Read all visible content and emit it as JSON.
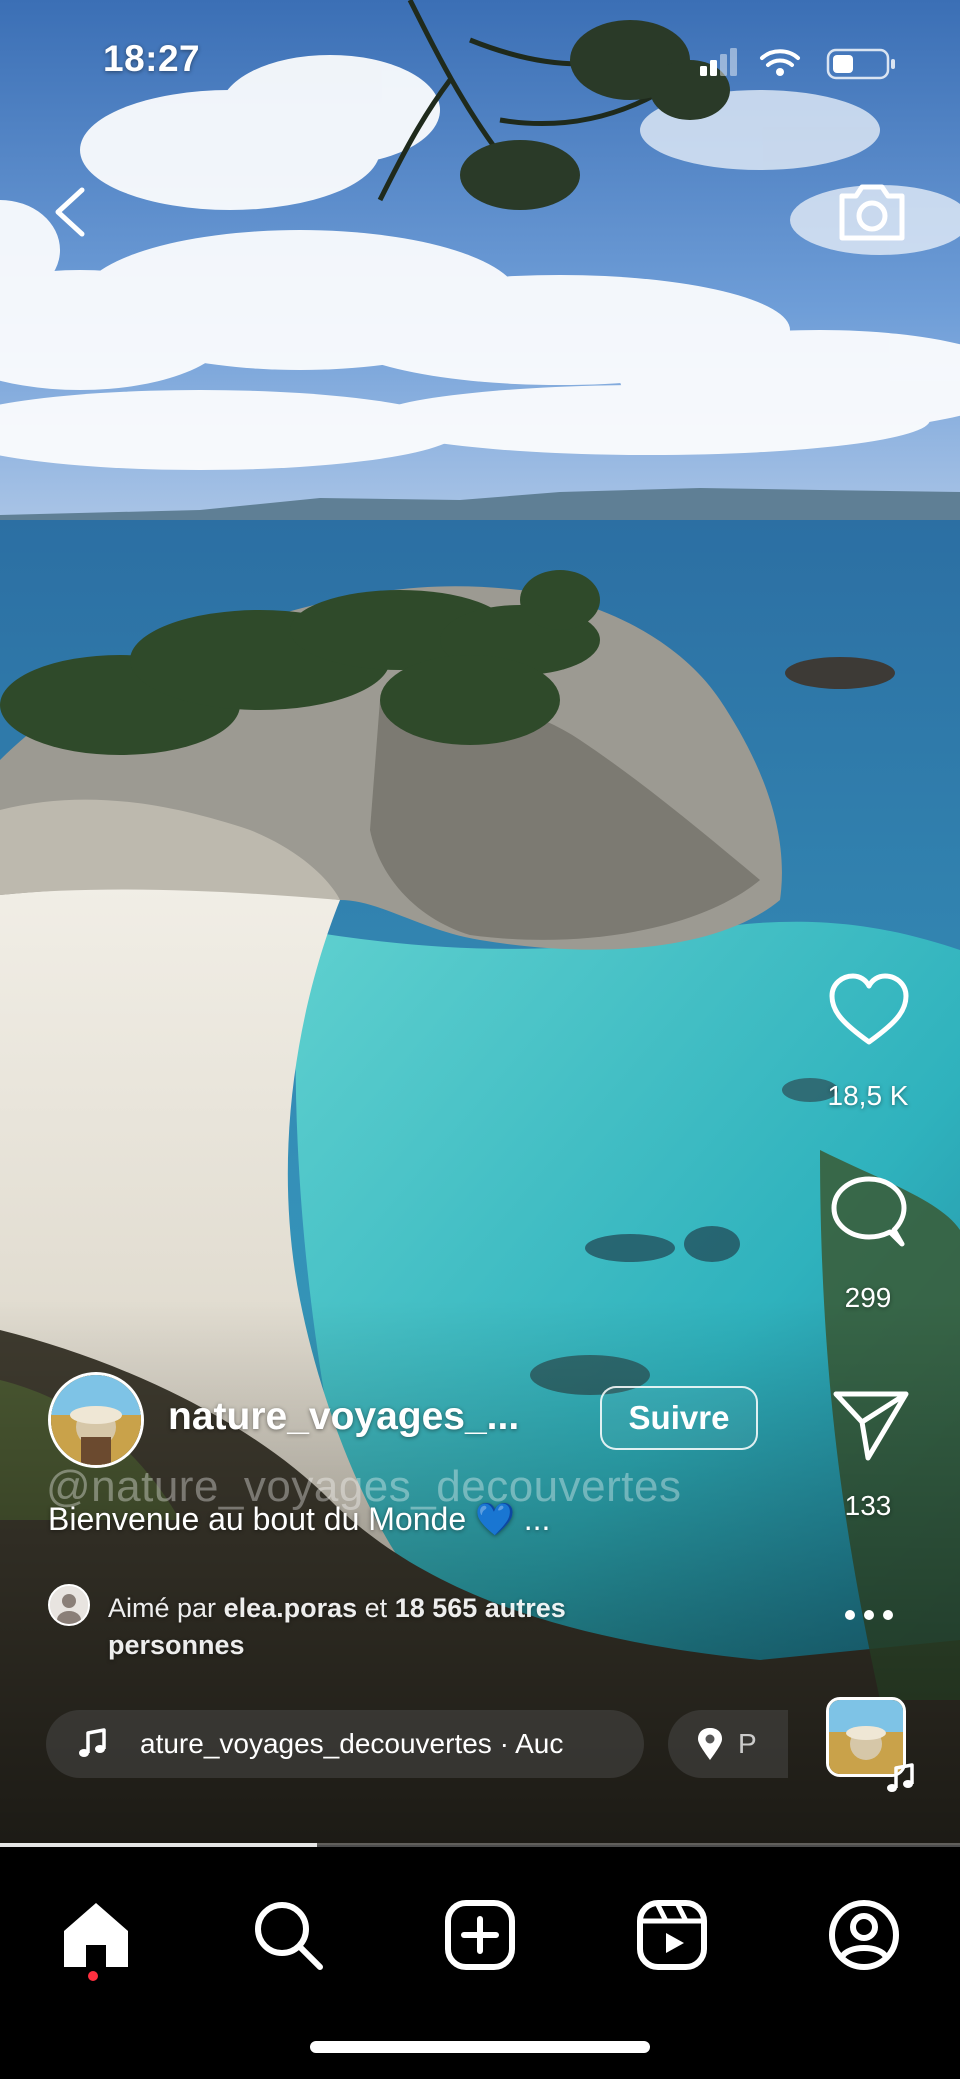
{
  "status_bar": {
    "time": "18:27"
  },
  "post": {
    "username": "nature_voyages_...",
    "follow_label": "Suivre",
    "watermark": "@nature_voyages_decouvertes",
    "caption": "Bienvenue au bout du Monde 💙 ...",
    "liked_prefix": "Aimé par",
    "liked_user": "elea.poras",
    "liked_joiner": "et",
    "liked_others": "18 565 autres personnes",
    "audio_text": "ature_voyages_decouvertes · Auc",
    "location_text": "P"
  },
  "actions": {
    "likes": "18,5 K",
    "comments": "299",
    "shares": "133"
  },
  "progress": {
    "fraction": 0.33
  },
  "colors": {
    "accent_dot": "#ff3040",
    "sea": "#3aa9b8",
    "sky": "#4f86c6"
  },
  "icons": {
    "back": "chevron-left-icon",
    "camera": "camera-icon",
    "like": "heart-icon",
    "comment": "comment-icon",
    "share": "send-icon",
    "more": "more-icon",
    "music": "music-note-icon",
    "location": "location-pin-icon"
  },
  "nav": [
    "home",
    "search",
    "create",
    "reels",
    "profile"
  ]
}
